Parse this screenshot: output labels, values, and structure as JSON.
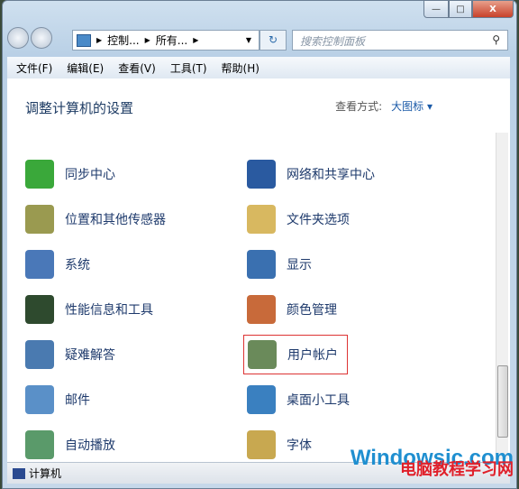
{
  "window": {
    "buttons": [
      "—",
      "□",
      "X"
    ]
  },
  "address": {
    "crumbs": [
      "控制...",
      "所有..."
    ],
    "refresh": "↻"
  },
  "search": {
    "placeholder": "搜索控制面板"
  },
  "menu": [
    "文件(F)",
    "编辑(E)",
    "查看(V)",
    "工具(T)",
    "帮助(H)"
  ],
  "page": {
    "title": "调整计算机的设置",
    "view_label": "查看方式:",
    "view_value": "大图标 ▾"
  },
  "items_left": [
    {
      "label": "同步中心",
      "color": "#3aa83a"
    },
    {
      "label": "位置和其他传感器",
      "color": "#9a9a50"
    },
    {
      "label": "系统",
      "color": "#4a78b8"
    },
    {
      "label": "性能信息和工具",
      "color": "#2e4a2e"
    },
    {
      "label": "疑难解答",
      "color": "#4a7ab0"
    },
    {
      "label": "邮件",
      "color": "#5a90c8"
    },
    {
      "label": "自动播放",
      "color": "#5a9a6a"
    }
  ],
  "items_right": [
    {
      "label": "网络和共享中心",
      "color": "#2a5aa0"
    },
    {
      "label": "文件夹选项",
      "color": "#d8b860"
    },
    {
      "label": "显示",
      "color": "#3a70b0"
    },
    {
      "label": "颜色管理",
      "color": "#c86a3a"
    },
    {
      "label": "用户帐户",
      "color": "#6a8a5a",
      "highlighted": true
    },
    {
      "label": "桌面小工具",
      "color": "#3a80c0"
    },
    {
      "label": "字体",
      "color": "#c8a850"
    }
  ],
  "status": {
    "text": "计算机"
  },
  "watermark": {
    "line1": "Windowsic.com",
    "line2": "电脑教程学习网"
  }
}
